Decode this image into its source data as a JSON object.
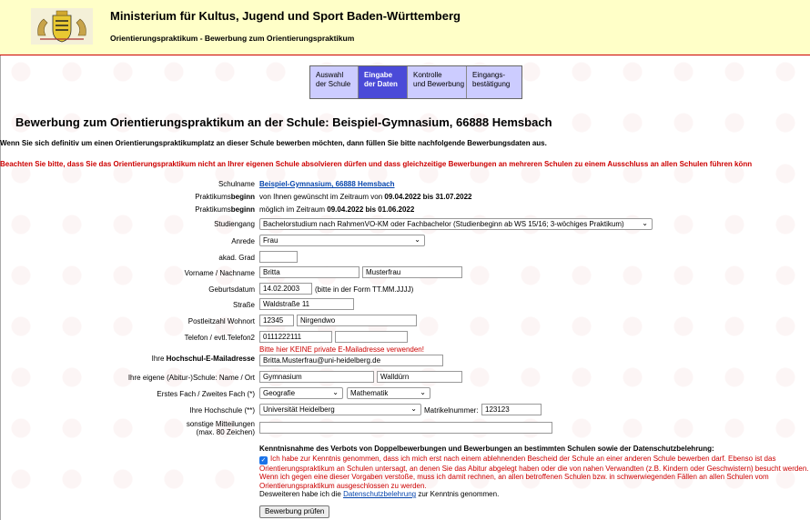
{
  "header": {
    "title": "Ministerium für Kultus, Jugend und Sport Baden-Württemberg",
    "subtitle": "Orientierungspraktikum - Bewerbung zum Orientierungspraktikum"
  },
  "steps": [
    {
      "line1": "Auswahl",
      "line2": "der Schule",
      "active": false
    },
    {
      "line1": "Eingabe",
      "line2": "der Daten",
      "active": true
    },
    {
      "line1": "Kontrolle",
      "line2": "und Bewerbung",
      "active": false
    },
    {
      "line1": "Eingangs-",
      "line2": "bestätigung",
      "active": false
    }
  ],
  "page_title": "Bewerbung zum Orientierungspraktikum an der Schule: Beispiel-Gymnasium, 66888 Hemsbach",
  "intro": "Wenn Sie sich definitiv um einen Orientierungspraktikumplatz an dieser Schule bewerben möchten, dann füllen Sie bitte nachfolgende Bewerbungsdaten aus.",
  "warning": "Beachten Sie bitte, dass Sie das Orientierungspraktikum nicht an Ihrer eigenen Schule absolvieren dürfen und dass gleichzeitige Bewerbungen an mehreren Schulen zu einem Ausschluss an allen Schulen führen könn",
  "form": {
    "schulname_label": "Schulname",
    "schulname_value": "Beispiel-Gymnasium, 66888 Hemsbach",
    "beginn_label_a": "Praktikums",
    "beginn_label_b": "beginn",
    "beginn1_pre": "von Ihnen gewünscht im Zeitraum von ",
    "beginn1_date1": "09.04.2022",
    "beginn1_mid": " bis ",
    "beginn1_date2": "31.07.2022",
    "beginn2_pre": "möglich im Zeitraum ",
    "beginn2_dates": "09.04.2022 bis 01.06.2022",
    "studiengang_label": "Studiengang",
    "studiengang_value": "Bachelorstudium nach RahmenVO-KM oder Fachbachelor (Studienbeginn ab WS 15/16; 3-wöchiges Praktikum)",
    "anrede_label": "Anrede",
    "anrede_value": "Frau",
    "grad_label": "akad. Grad",
    "grad_value": "",
    "name_label": "Vorname / Nachname",
    "vorname_value": "Britta",
    "nachname_value": "Musterfrau",
    "geburt_label": "Geburtsdatum",
    "geburt_value": "14.02.2003",
    "geburt_hint": "(bitte in der Form TT.MM.JJJJ)",
    "strasse_label": "Straße",
    "strasse_value": "Waldstraße 11",
    "plz_label": "Postleitzahl Wohnort",
    "plz_value": "12345",
    "ort_value": "Nirgendwo",
    "telefon_label": "Telefon / evtl.Telefon2",
    "telefon_value": "0111222111",
    "telefon2_value": "",
    "email_warning": "Bitte hier KEINE private E-Mailadresse verwenden!",
    "email_label_a": "Ihre ",
    "email_label_b": "Hochschul-E-Mailadresse",
    "email_value": "Britta.Musterfrau@uni-heidelberg.de",
    "schule_label": "Ihre eigene (Abitur-)Schule: Name / Ort",
    "schule_name_value": "Gymnasium",
    "schule_ort_value": "Walldürn",
    "fach_label": "Erstes Fach / Zweites Fach (*)",
    "fach1_value": "Geografie",
    "fach2_value": "Mathematik",
    "hochschule_label": "Ihre Hochschule (**)",
    "hochschule_value": "Universität Heidelberg",
    "matrikel_label": "Matrikelnummer:",
    "matrikel_value": "123123",
    "sonstige_label1": "sonstige Mitteilungen",
    "sonstige_label2": "(max. 80 Zeichen)",
    "sonstige_value": ""
  },
  "consent": {
    "title": "Kenntnisnahme des Verbots von Doppelbewerbungen und Bewerbungen an bestimmten Schulen sowie der Datenschutzbelehrung:",
    "text": "Ich habe zur Kenntnis genommen, dass ich mich erst nach einem ablehnenden Bescheid der Schule an einer anderen Schule bewerben darf. Ebenso ist das Orientierungspraktikum an Schulen untersagt, an denen Sie das Abitur abgelegt haben oder die von nahen Verwandten (z.B. Kindern oder Geschwistern) besucht werden. Wenn ich gegen eine dieser Vorgaben verstoße, muss ich damit rechnen, an allen betroffenen Schulen bzw. in schwerwiegenden Fällen an allen Schulen vom Orientierungspraktikum ausgeschlossen zu werden.",
    "checked": true,
    "privacy_pre": "Desweiteren habe ich die ",
    "privacy_link": "Datenschutzbelehrung",
    "privacy_post": " zur Kenntnis genommen."
  },
  "submit_label": "Bewerbung prüfen"
}
